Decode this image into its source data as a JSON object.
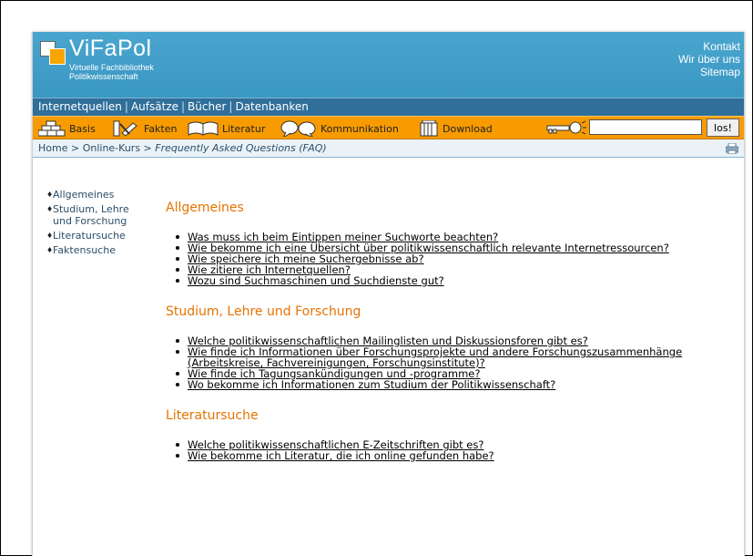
{
  "header": {
    "logo": "ViFaPol",
    "subtitle_line1": "Virtuelle Fachbibliothek",
    "subtitle_line2": "Politikwissenschaft",
    "links": [
      "Kontakt",
      "Wir über uns",
      "Sitemap"
    ]
  },
  "navbar": {
    "items": [
      "Internetquellen",
      "Aufsätze",
      "Bücher",
      "Datenbanken"
    ],
    "separator": "|"
  },
  "toolbar": {
    "items": [
      "Basis",
      "Fakten",
      "Literatur",
      "Kommunikation",
      "Download"
    ],
    "search_value": "",
    "search_button": "los!"
  },
  "breadcrumb": {
    "home": "Home",
    "sep": ">",
    "course": "Online-Kurs",
    "current": "Frequently Asked Questions (FAQ)"
  },
  "sidenav": [
    "Allgemeines",
    "Studium, Lehre und Forschung",
    "Literatursuche",
    "Faktensuche"
  ],
  "sections": [
    {
      "title": "Allgemeines",
      "questions": [
        "Was muss ich beim Eintippen meiner Suchworte beachten?",
        "Wie bekomme ich eine Übersicht über politikwissenschaftlich relevante Internetressourcen?",
        "Wie speichere ich meine Suchergebnisse ab?",
        "Wie zitiere ich Internetquellen?",
        "Wozu sind Suchmaschinen und Suchdienste gut?"
      ]
    },
    {
      "title": "Studium, Lehre und Forschung",
      "questions": [
        "Welche politikwissenschaftlichen Mailinglisten und Diskussionsforen gibt es?",
        "Wie finde ich Informationen über Forschungsprojekte und andere Forschungszusammenhänge (Arbeitskreise, Fachvereinigungen, Forschungsinstitute)?",
        "Wie finde ich Tagungsankündigungen und -programme?",
        "Wo bekomme ich Informationen zum Studium der Politikwissenschaft?"
      ]
    },
    {
      "title": "Literatursuche",
      "questions": [
        "Welche politikwissenschaftlichen E-Zeitschriften gibt es?",
        "Wie bekomme ich Literatur, die ich online gefunden habe?"
      ]
    }
  ],
  "colors": {
    "header_blue": "#3a97c2",
    "nav_blue": "#2f6f99",
    "toolbar_orange": "#f89b00",
    "section_orange": "#e67300"
  }
}
